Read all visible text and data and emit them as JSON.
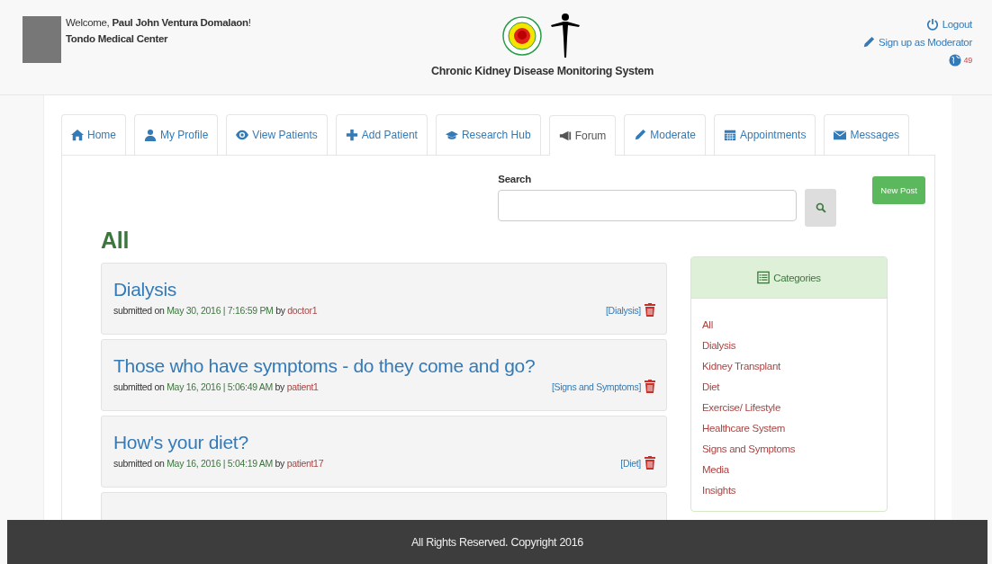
{
  "user": {
    "welcome": "Welcome, **Paul John Ventura Domalaon**!",
    "organization": "Tondo Medical Center"
  },
  "header": {
    "title": "Chronic Kidney Disease Monitoring System"
  },
  "account_links": [
    {
      "kind": "logout",
      "label": "Logout"
    },
    {
      "kind": "moderator",
      "label": "Sign up as Moderator"
    }
  ],
  "notifications": {
    "count": "49"
  },
  "tabs": [
    {
      "kind": "home",
      "label": "Home",
      "selected": false
    },
    {
      "kind": "profile",
      "label": "My Profile",
      "selected": false
    },
    {
      "kind": "view",
      "label": "View Patients",
      "selected": false
    },
    {
      "kind": "add",
      "label": "Add Patient",
      "selected": false
    },
    {
      "kind": "research",
      "label": "Research Hub",
      "selected": false
    },
    {
      "kind": "forum",
      "label": "Forum",
      "selected": true
    },
    {
      "kind": "moderate",
      "label": "Moderate",
      "selected": false
    },
    {
      "kind": "appointments",
      "label": "Appointments",
      "selected": false
    },
    {
      "kind": "messages",
      "label": "Messages",
      "selected": false
    }
  ],
  "search": {
    "label": "Search"
  },
  "new_post_button": "New Post",
  "heading": "All",
  "posts": [
    {
      "title": "Dialysis",
      "prefix": "submitted on",
      "date": "May 30, 2016 | 7:16:59 PM",
      "by": "by",
      "author": "doctor1",
      "category": "[Dialysis]"
    },
    {
      "title": "Those who have symptoms - do they come and go?",
      "prefix": "submitted on",
      "date": "May 16, 2016 | 5:06:49 AM",
      "by": "by",
      "author": "patient1",
      "category": "[Signs and Symptoms]"
    },
    {
      "title": "How's your diet?",
      "prefix": "submitted on",
      "date": "May 16, 2016 | 5:04:19 AM",
      "by": "by",
      "author": "patient17",
      "category": "[Diet]"
    },
    {
      "partial": true
    }
  ],
  "categories": {
    "title": "Categories",
    "items": [
      "All",
      "Dialysis",
      "Kidney Transplant",
      "Diet",
      "Exercise/ Lifestyle",
      "Healthcare System",
      "Signs and Symptoms",
      "Media",
      "Insights"
    ]
  },
  "footer": "All Rights Reserved. Copyright 2016"
}
